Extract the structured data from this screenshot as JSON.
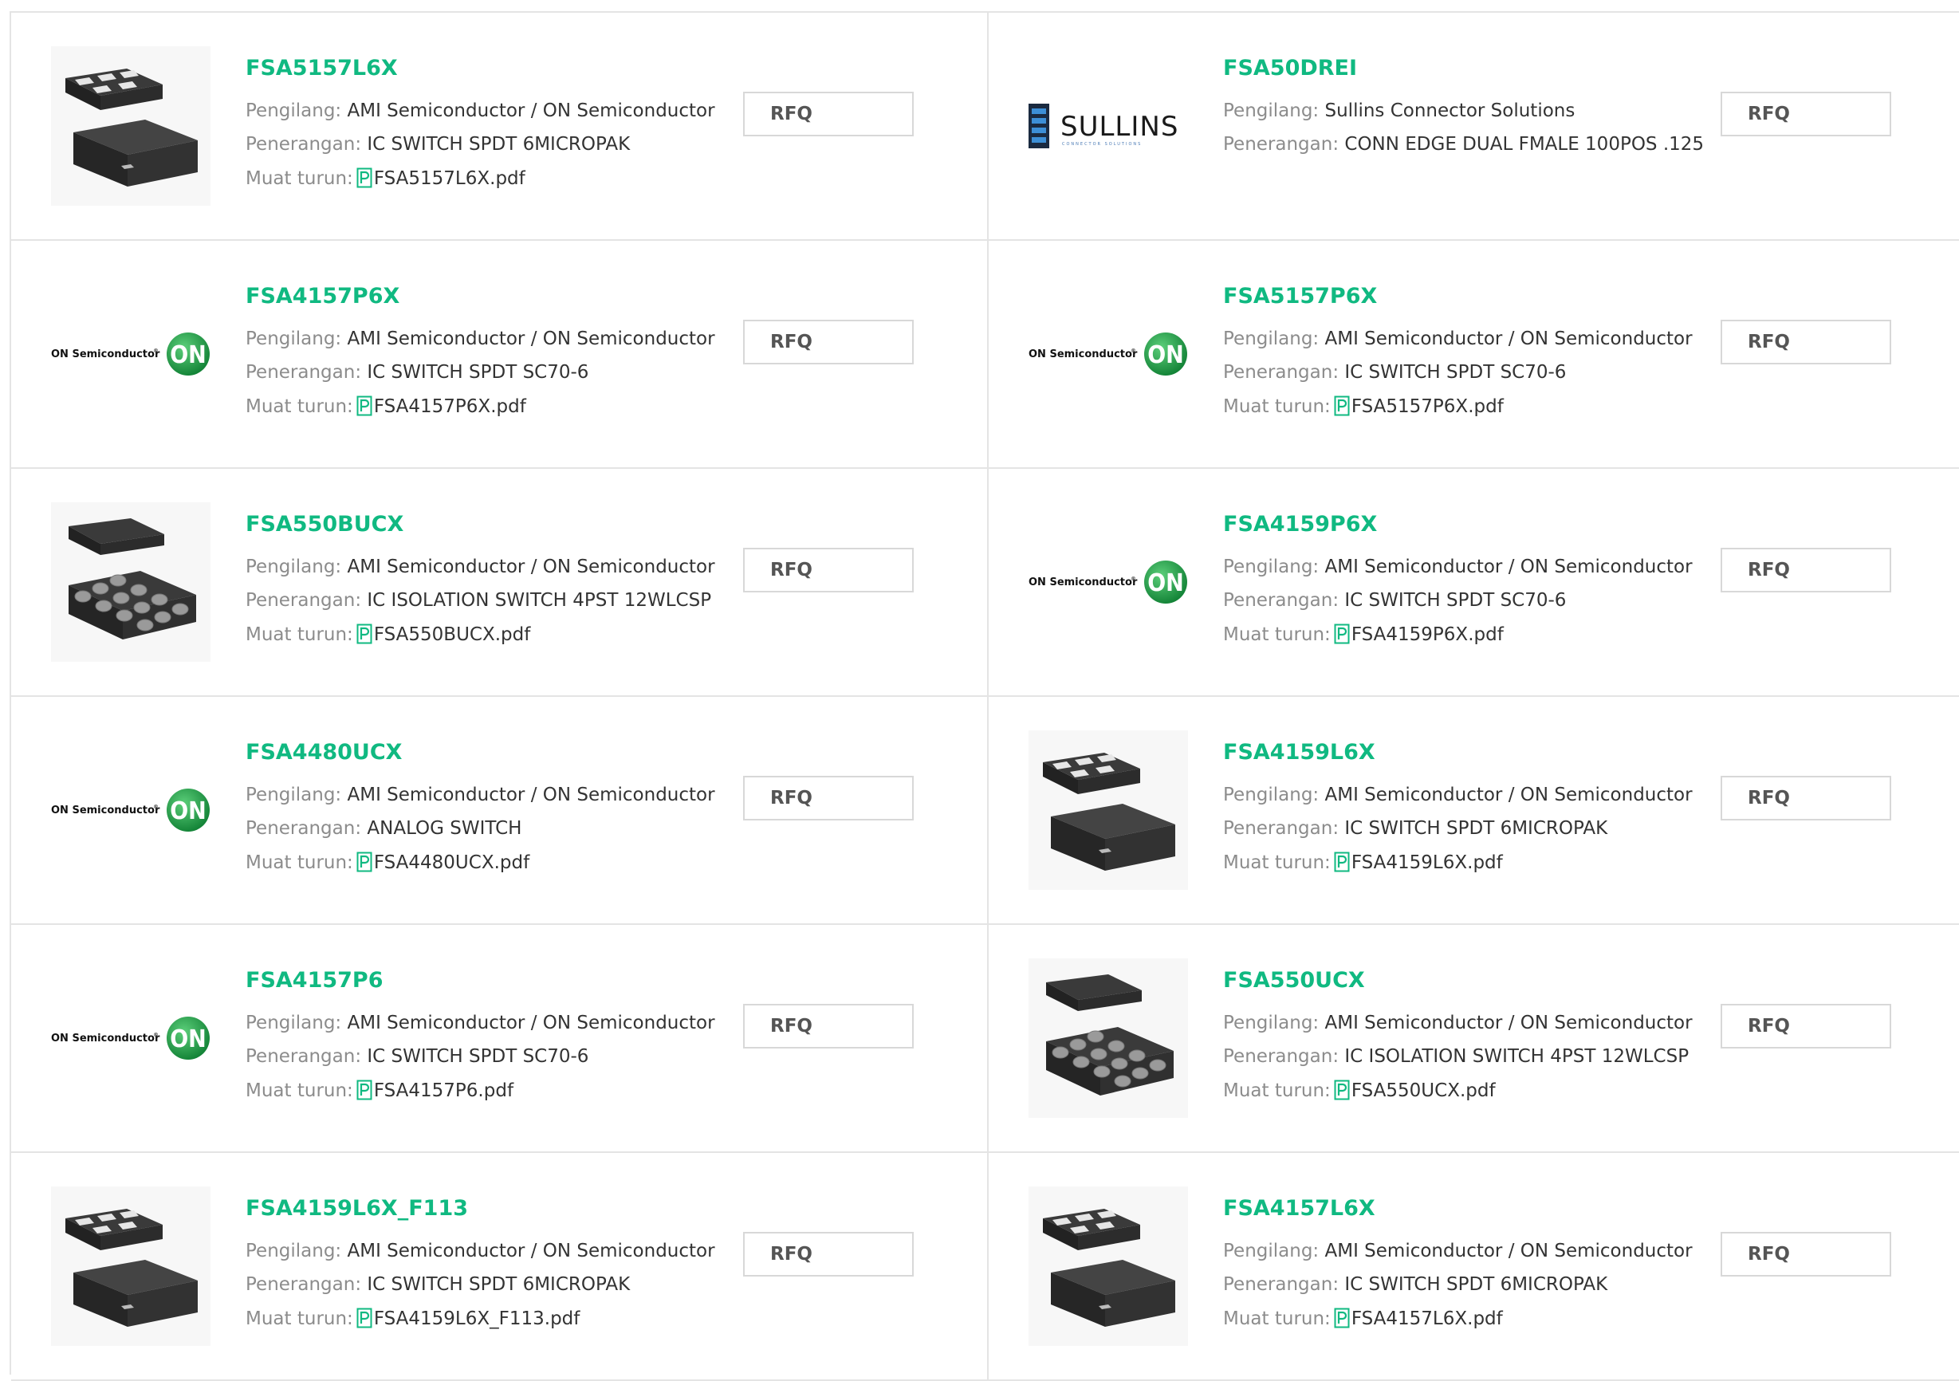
{
  "labels": {
    "manufacturer": "Pengilang:",
    "description": "Penerangan:",
    "download": "Muat turun:",
    "rfq": "RFQ"
  },
  "colors": {
    "title": "#10b981",
    "border": "#e4e4e4",
    "on_logo": "#1aa04a"
  },
  "products": [
    {
      "part": "FSA5157L6X",
      "manufacturer": "AMI Semiconductor / ON Semiconductor",
      "description": "IC SWITCH SPDT 6MICROPAK",
      "pdf": "FSA5157L6X.pdf",
      "image": "micropak-package-image"
    },
    {
      "part": "FSA50DREI",
      "manufacturer": "Sullins Connector Solutions",
      "description": "CONN EDGE DUAL FMALE 100POS .125",
      "pdf": "",
      "image": "sullins-logo"
    },
    {
      "part": "FSA4157P6X",
      "manufacturer": "AMI Semiconductor / ON Semiconductor",
      "description": "IC SWITCH SPDT SC70-6",
      "pdf": "FSA4157P6X.pdf",
      "image": "on-semiconductor-logo"
    },
    {
      "part": "FSA5157P6X",
      "manufacturer": "AMI Semiconductor / ON Semiconductor",
      "description": "IC SWITCH SPDT SC70-6",
      "pdf": "FSA5157P6X.pdf",
      "image": "on-semiconductor-logo"
    },
    {
      "part": "FSA550BUCX",
      "manufacturer": "AMI Semiconductor / ON Semiconductor",
      "description": "IC ISOLATION SWITCH 4PST 12WLCSP",
      "pdf": "FSA550BUCX.pdf",
      "image": "wlcsp-package-image"
    },
    {
      "part": "FSA4159P6X",
      "manufacturer": "AMI Semiconductor / ON Semiconductor",
      "description": "IC SWITCH SPDT SC70-6",
      "pdf": "FSA4159P6X.pdf",
      "image": "on-semiconductor-logo"
    },
    {
      "part": "FSA4480UCX",
      "manufacturer": "AMI Semiconductor / ON Semiconductor",
      "description": "ANALOG SWITCH",
      "pdf": "FSA4480UCX.pdf",
      "image": "on-semiconductor-logo"
    },
    {
      "part": "FSA4159L6X",
      "manufacturer": "AMI Semiconductor / ON Semiconductor",
      "description": "IC SWITCH SPDT 6MICROPAK",
      "pdf": "FSA4159L6X.pdf",
      "image": "micropak-package-image"
    },
    {
      "part": "FSA4157P6",
      "manufacturer": "AMI Semiconductor / ON Semiconductor",
      "description": "IC SWITCH SPDT SC70-6",
      "pdf": "FSA4157P6.pdf",
      "image": "on-semiconductor-logo"
    },
    {
      "part": "FSA550UCX",
      "manufacturer": "AMI Semiconductor / ON Semiconductor",
      "description": "IC ISOLATION SWITCH 4PST 12WLCSP",
      "pdf": "FSA550UCX.pdf",
      "image": "wlcsp-package-image"
    },
    {
      "part": "FSA4159L6X_F113",
      "manufacturer": "AMI Semiconductor / ON Semiconductor",
      "description": "IC SWITCH SPDT 6MICROPAK",
      "pdf": "FSA4159L6X_F113.pdf",
      "image": "micropak-package-image"
    },
    {
      "part": "FSA4157L6X",
      "manufacturer": "AMI Semiconductor / ON Semiconductor",
      "description": "IC SWITCH SPDT 6MICROPAK",
      "pdf": "FSA4157L6X.pdf",
      "image": "micropak-package-image"
    }
  ]
}
